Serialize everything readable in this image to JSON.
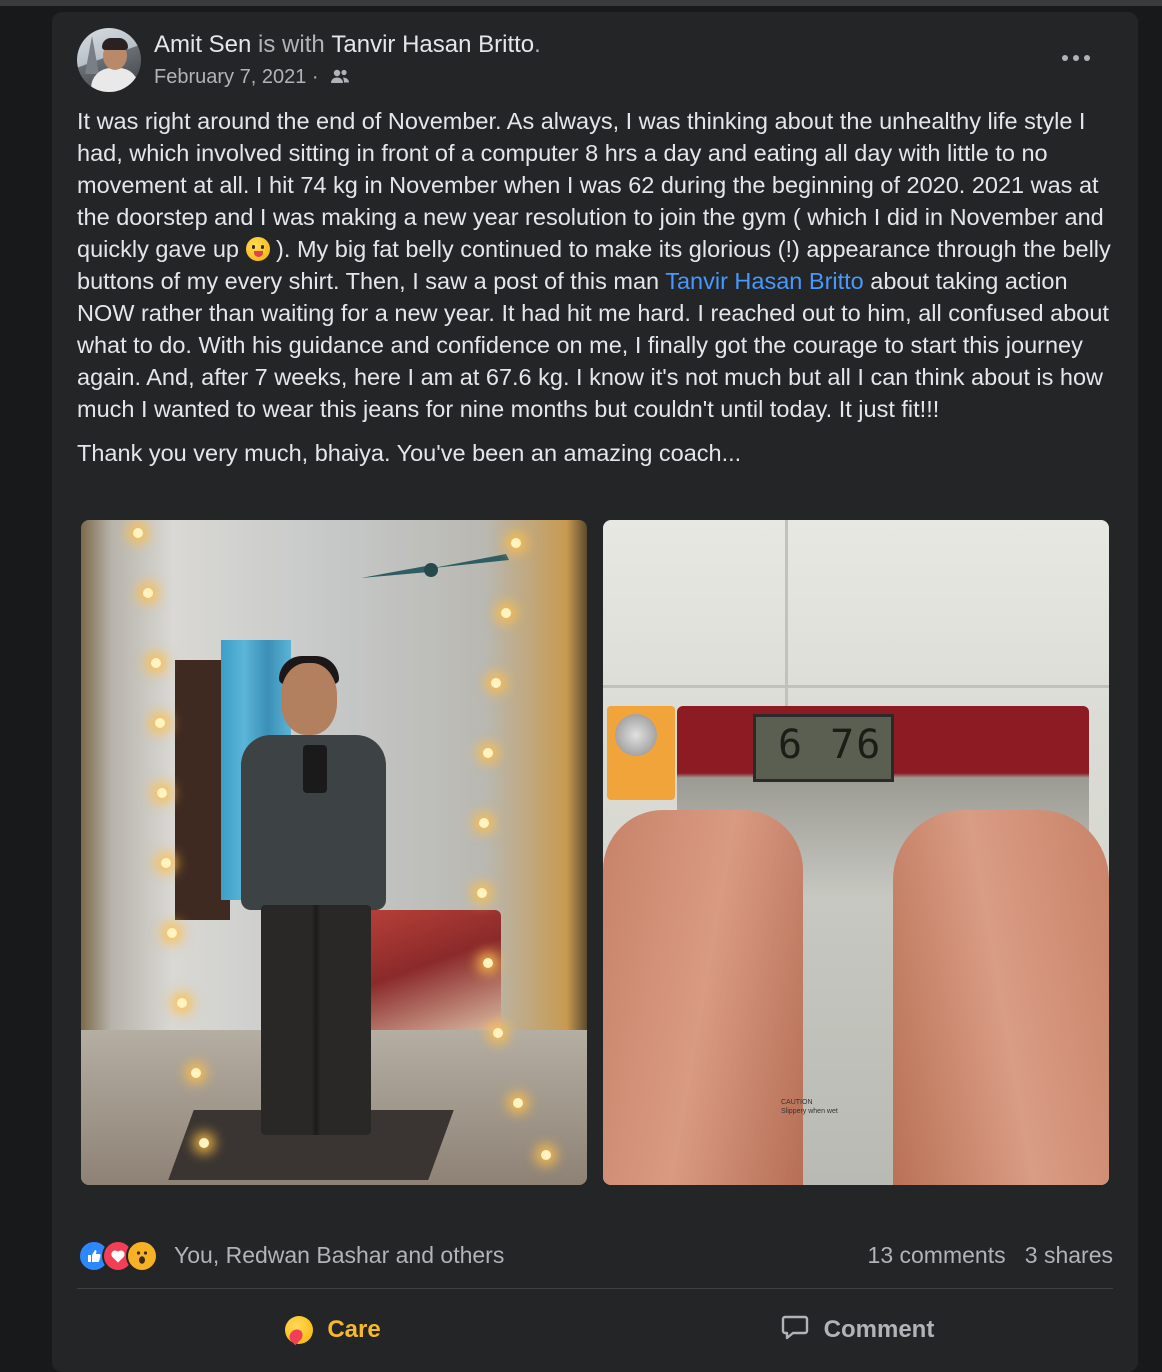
{
  "post": {
    "author": "Amit Sen",
    "with_text": " is with ",
    "tagged": "Tanvir Hasan Britto",
    "tag_end": ".",
    "date": "February 7, 2021 ·",
    "audience_icon": "friends-icon",
    "more_icon": "more-options-icon",
    "paragraph1_a": "It was right around the end of November. As always, I was thinking about the unhealthy life style I had, which involved sitting in front of a computer 8 hrs a day and eating all day with little to no movement at all. I hit 74 kg in November when I was 62 during the beginning of 2020. 2021 was at the doorstep and I was making a new year resolution to join the gym ( which I did in November and quickly gave up ",
    "paragraph1_emoji": "face-with-tongue-emoji",
    "paragraph1_b": " ). My big fat belly continued to make its glorious (!) appearance through the belly buttons of my every shirt. Then, I saw a post of this man ",
    "paragraph1_link": "Tanvir Hasan Britto",
    "paragraph1_c": " about taking action NOW rather than waiting for a new year. It had hit me hard. I reached out to him, all confused about what to do. With his guidance and confidence on me, I finally got the courage to start this journey again. And, after 7 weeks, here I am at 67.6 kg. I know it's not much but all I can think about is how much I wanted to wear this jeans for nine months but couldn't until today. It just fit!!!",
    "paragraph2": "Thank you very much, bhaiya. You've been an amazing coach...",
    "scale_reading": "6 76"
  },
  "reactions": {
    "icons": [
      "like-icon",
      "love-icon",
      "wow-icon"
    ],
    "text": "You, Redwan Bashar and others",
    "comments": "13 comments",
    "shares": "3 shares"
  },
  "actions": {
    "care_label": "Care",
    "comment_label": "Comment"
  },
  "colors": {
    "background": "#18191a",
    "card": "#242526",
    "link": "#4599ff",
    "care": "#f7b928"
  }
}
